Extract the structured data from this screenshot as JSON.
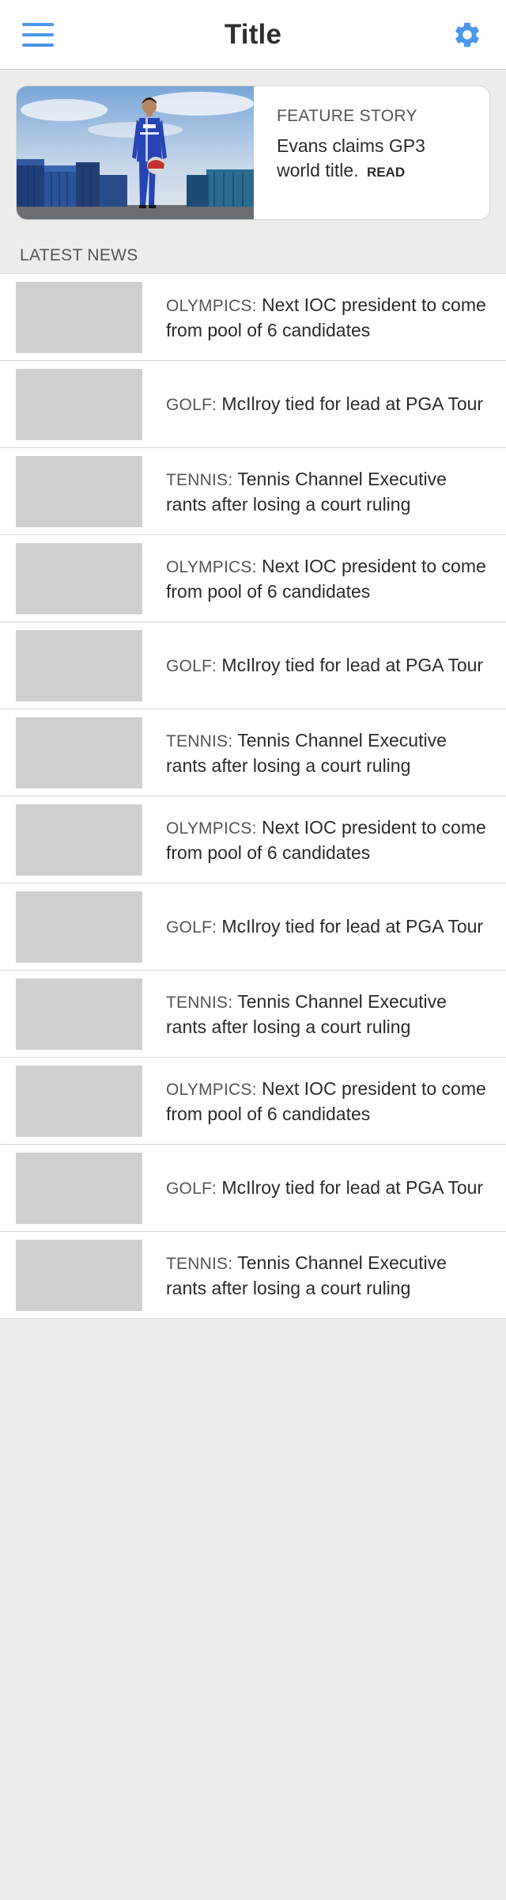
{
  "header": {
    "title": "Title",
    "menu_icon": "hamburger-menu-icon",
    "settings_icon": "gear-icon",
    "accent_color": "#4a97ea"
  },
  "feature": {
    "kicker": "FEATURE STORY",
    "headline": "Evans claims GP3 world title.",
    "read_label": "READ",
    "image": "racing driver in blue suit standing in front of shipping containers"
  },
  "latest": {
    "label": "LATEST NEWS",
    "items": [
      {
        "category": "OLYMPICS:",
        "headline": "Next IOC president to come from pool of 6 candidates"
      },
      {
        "category": "GOLF:",
        "headline": "McIlroy tied for lead at PGA Tour"
      },
      {
        "category": "TENNIS:",
        "headline": "Tennis Channel Executive rants after losing a court ruling"
      },
      {
        "category": "OLYMPICS:",
        "headline": "Next IOC president to come from pool of 6 candidates"
      },
      {
        "category": "GOLF:",
        "headline": "McIlroy tied for lead at PGA Tour"
      },
      {
        "category": "TENNIS:",
        "headline": "Tennis Channel Executive rants after losing a court ruling"
      },
      {
        "category": "OLYMPICS:",
        "headline": "Next IOC president to come from pool of 6 candidates"
      },
      {
        "category": "GOLF:",
        "headline": "McIlroy tied for lead at PGA Tour"
      },
      {
        "category": "TENNIS:",
        "headline": "Tennis Channel Executive rants after losing a court ruling"
      },
      {
        "category": "OLYMPICS:",
        "headline": "Next IOC president to come from pool of 6 candidates"
      },
      {
        "category": "GOLF:",
        "headline": "McIlroy tied for lead at PGA Tour"
      },
      {
        "category": "TENNIS:",
        "headline": "Tennis Channel Executive rants after losing a court ruling"
      }
    ]
  }
}
